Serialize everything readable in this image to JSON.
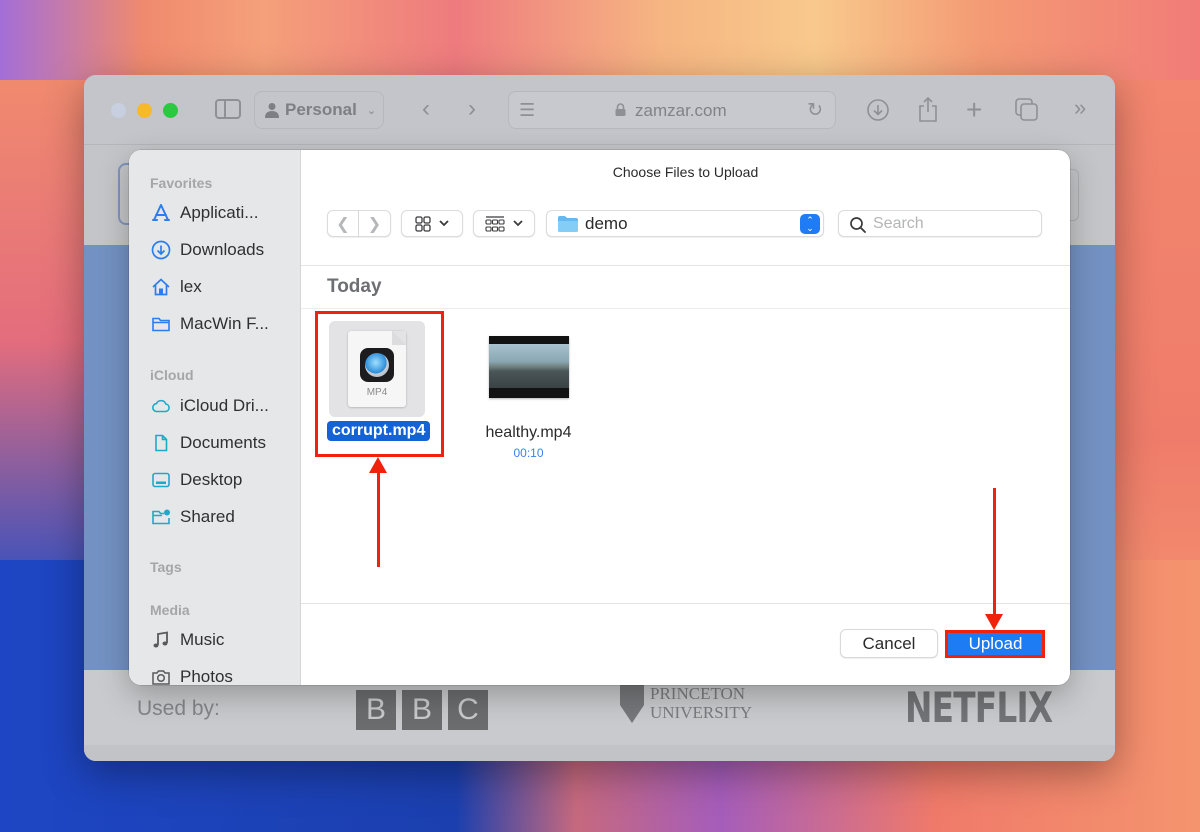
{
  "browser": {
    "profile_label": "Personal",
    "url": "zamzar.com",
    "icons": [
      "sidebar-icon",
      "person-icon",
      "back-icon",
      "forward-icon",
      "reader-icon",
      "lock-icon",
      "reload-icon",
      "download-icon",
      "share-icon",
      "new-tab-icon",
      "tab-overview-icon",
      "more-icon"
    ]
  },
  "page": {
    "used_by_label": "Used by:",
    "logos": {
      "bbc": [
        "B",
        "B",
        "C"
      ],
      "princeton_line1": "PRINCETON",
      "princeton_line2": "UNIVERSITY",
      "netflix": "NETFLIX"
    }
  },
  "dialog": {
    "title": "Choose Files to Upload",
    "sidebar": {
      "sections": [
        {
          "title": "Favorites",
          "items": [
            {
              "label": "Applicati...",
              "icon": "applications-icon"
            },
            {
              "label": "Downloads",
              "icon": "downloads-icon"
            },
            {
              "label": "lex",
              "icon": "home-icon"
            },
            {
              "label": "MacWin F...",
              "icon": "folder-icon"
            }
          ]
        },
        {
          "title": "iCloud",
          "items": [
            {
              "label": "iCloud Dri...",
              "icon": "cloud-icon"
            },
            {
              "label": "Documents",
              "icon": "document-icon"
            },
            {
              "label": "Desktop",
              "icon": "desktop-icon"
            },
            {
              "label": "Shared",
              "icon": "shared-folder-icon"
            }
          ]
        },
        {
          "title": "Tags",
          "items": []
        },
        {
          "title": "Media",
          "items": [
            {
              "label": "Music",
              "icon": "music-icon"
            },
            {
              "label": "Photos",
              "icon": "camera-icon"
            }
          ]
        }
      ]
    },
    "toolbar": {
      "current_folder": "demo",
      "search_placeholder": "Search",
      "search_value": ""
    },
    "group_title": "Today",
    "files": [
      {
        "name": "corrupt.mp4",
        "type_label": "MP4",
        "selected": true
      },
      {
        "name": "healthy.mp4",
        "duration": "00:10",
        "selected": false
      }
    ],
    "buttons": {
      "cancel": "Cancel",
      "upload": "Upload"
    }
  },
  "colors": {
    "accent": "#1d7cf4",
    "selection": "#1463d6",
    "annotation": "#f0220c"
  }
}
